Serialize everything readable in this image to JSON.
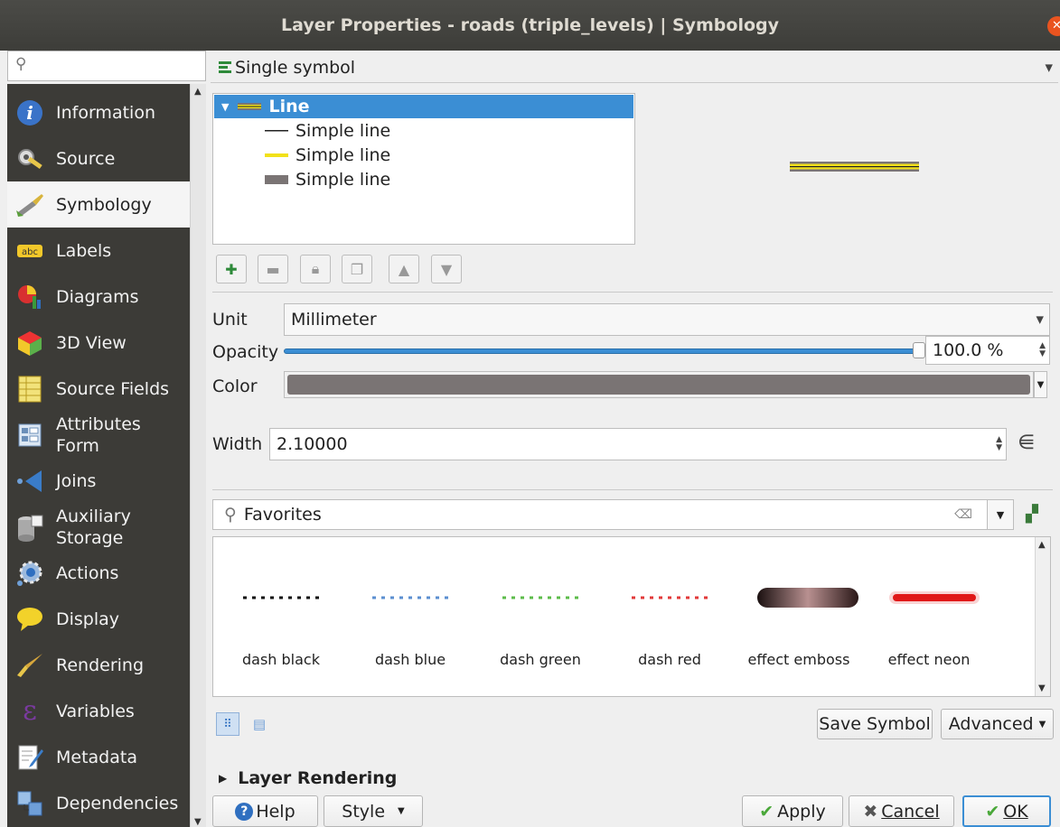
{
  "window": {
    "title": "Layer Properties - roads (triple_levels) | Symbology"
  },
  "sidebar": {
    "search_placeholder": "",
    "items": [
      {
        "label": "Information",
        "icon": "info-icon"
      },
      {
        "label": "Source",
        "icon": "source-settings-icon"
      },
      {
        "label": "Symbology",
        "icon": "paintbrush-icon",
        "active": true
      },
      {
        "label": "Labels",
        "icon": "abc-label-icon"
      },
      {
        "label": "Diagrams",
        "icon": "diagram-icon"
      },
      {
        "label": "3D View",
        "icon": "cube-icon"
      },
      {
        "label": "Source Fields",
        "icon": "fields-table-icon"
      },
      {
        "label": "Attributes",
        "label2": "Form",
        "icon": "form-icon"
      },
      {
        "label": "Joins",
        "icon": "joins-icon"
      },
      {
        "label": "Auxiliary",
        "label2": "Storage",
        "icon": "database-icon"
      },
      {
        "label": "Actions",
        "icon": "gear-action-icon"
      },
      {
        "label": "Display",
        "icon": "speech-bubble-icon"
      },
      {
        "label": "Rendering",
        "icon": "brush-icon"
      },
      {
        "label": "Variables",
        "icon": "epsilon-icon"
      },
      {
        "label": "Metadata",
        "icon": "document-edit-icon"
      },
      {
        "label": "Dependencies",
        "icon": "dependencies-icon"
      }
    ]
  },
  "renderer": {
    "label": "Single symbol"
  },
  "symbol_tree": {
    "root": "Line",
    "layers": [
      {
        "label": "Simple line",
        "swatch": "#222222"
      },
      {
        "label": "Simple line",
        "swatch": "#f2e11a"
      },
      {
        "label": "Simple line",
        "swatch": "#7a7474"
      }
    ]
  },
  "properties": {
    "unit_label": "Unit",
    "unit_value": "Millimeter",
    "opacity_label": "Opacity",
    "opacity_value": "100.0 %",
    "opacity_fraction": 1.0,
    "color_label": "Color",
    "color_value": "#7a7474",
    "width_label": "Width",
    "width_value": "2.10000"
  },
  "library": {
    "search_value": "Favorites",
    "symbols": [
      {
        "name": "dash  black",
        "style": "dash",
        "color": "#111111"
      },
      {
        "name": "dash blue",
        "style": "dash",
        "color": "#5b8fd0"
      },
      {
        "name": "dash green",
        "style": "dash",
        "color": "#5cbc4a"
      },
      {
        "name": "dash red",
        "style": "dash",
        "color": "#e23a3a"
      },
      {
        "name": "effect emboss",
        "style": "emboss",
        "color": "#8a6f6f"
      },
      {
        "name": "effect neon",
        "style": "neon",
        "color": "#e01818"
      }
    ],
    "save_label": "Save Symbol",
    "advanced_label": "Advanced"
  },
  "layer_rendering": {
    "label": "Layer Rendering"
  },
  "buttons": {
    "help": "Help",
    "style": "Style",
    "apply": "Apply",
    "cancel": "Cancel",
    "ok": "OK"
  }
}
